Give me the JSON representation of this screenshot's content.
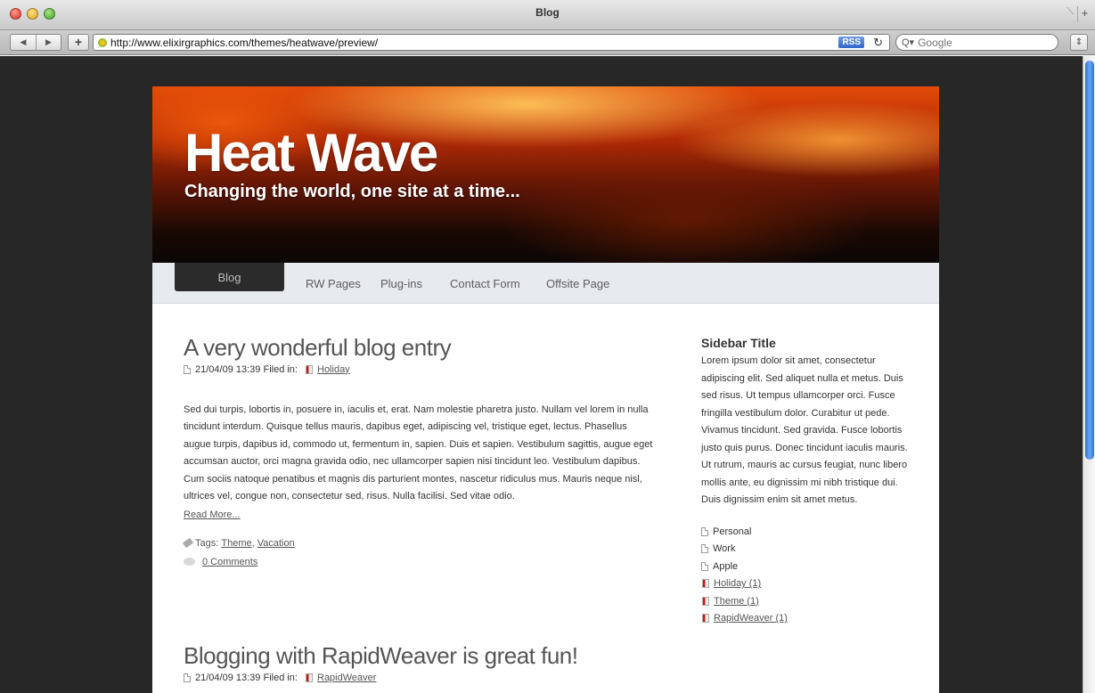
{
  "window": {
    "title": "Blog"
  },
  "toolbar": {
    "url": "http://www.elixirgraphics.com/themes/heatwave/preview/",
    "rss_label": "RSS",
    "search_placeholder": "Google"
  },
  "site": {
    "title": "Heat Wave",
    "tagline": "Changing the world, one site at a time..."
  },
  "nav": {
    "items": [
      "Blog",
      "RW Pages",
      "Plug-ins",
      "Contact Form",
      "Offsite Page"
    ],
    "active_index": 0
  },
  "posts": [
    {
      "title": "A very wonderful blog entry",
      "date": "21/04/09 13:39",
      "filed_in_label": "Filed in:",
      "category": "Holiday",
      "body": "Sed dui turpis, lobortis in, posuere in, iaculis et, erat. Nam molestie pharetra justo. Nullam vel lorem in nulla tincidunt interdum. Quisque tellus mauris, dapibus eget, adipiscing vel, tristique eget, lectus. Phasellus augue turpis, dapibus id, commodo ut, fermentum in, sapien. Duis et sapien. Vestibulum sagittis, augue eget accumsan auctor, orci magna gravida odio, nec ullamcorper sapien nisi tincidunt leo. Vestibulum dapibus. Cum sociis natoque penatibus et magnis dis parturient montes, nascetur ridiculus mus. Mauris neque nisl, ultrices vel, congue non, consectetur sed, risus. Nulla facilisi. Sed vitae odio.",
      "read_more": "Read More...",
      "tags_label": "Tags:",
      "tags": [
        "Theme",
        "Vacation"
      ],
      "comments": "0 Comments"
    },
    {
      "title": "Blogging with RapidWeaver is great fun!",
      "date": "21/04/09 13:39",
      "filed_in_label": "Filed in:",
      "category": "RapidWeaver"
    }
  ],
  "sidebar": {
    "title": "Sidebar Title",
    "text": "Lorem ipsum dolor sit amet, consectetur adipiscing elit. Sed aliquet nulla et metus. Duis sed risus. Ut tempus ullamcorper orci. Fusce fringilla vestibulum dolor. Curabitur ut pede. Vivamus tincidunt. Sed gravida. Fusce lobortis justo quis purus. Donec tincidunt iaculis mauris. Ut rutrum, mauris ac cursus feugiat, nunc libero mollis ante, eu dignissim mi nibh tristique dui. Duis dignissim enim sit amet metus.",
    "pages": [
      "Personal",
      "Work",
      "Apple"
    ],
    "categories": [
      "Holiday (1)",
      "Theme (1)",
      "RapidWeaver (1)"
    ]
  }
}
